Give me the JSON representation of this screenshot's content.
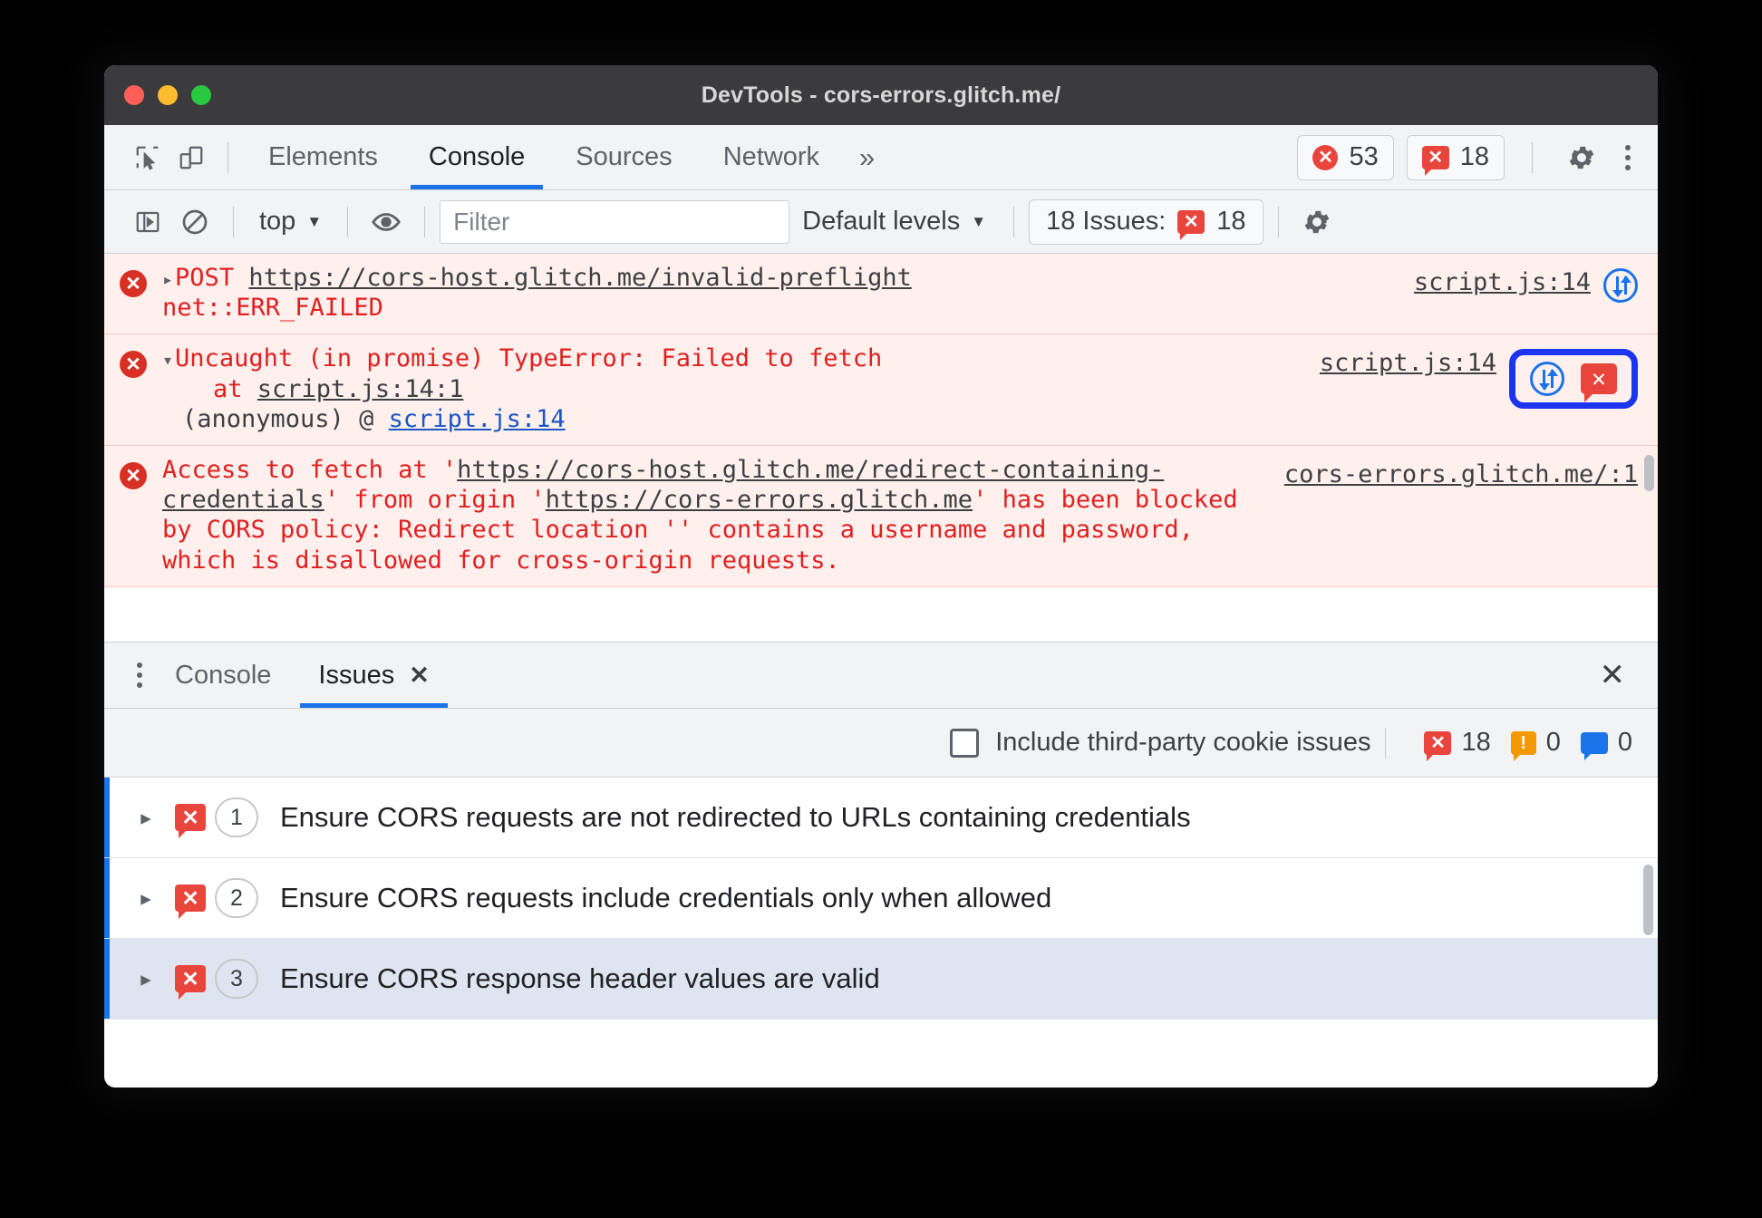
{
  "window": {
    "title": "DevTools - cors-errors.glitch.me/"
  },
  "main_tabs": {
    "inspect_icon": "inspect-cursor-icon",
    "device_icon": "device-toolbar-icon",
    "items": [
      {
        "label": "Elements",
        "active": false
      },
      {
        "label": "Console",
        "active": true
      },
      {
        "label": "Sources",
        "active": false
      },
      {
        "label": "Network",
        "active": false
      }
    ],
    "more_label": "»",
    "error_count": "53",
    "issue_count": "18",
    "settings_icon": "gear-icon",
    "menu_icon": "kebab-menu-icon"
  },
  "console_toolbar": {
    "sidebar_icon": "console-sidebar-icon",
    "clear_icon": "clear-console-icon",
    "context": "top",
    "eye_icon": "live-expression-icon",
    "filter_placeholder": "Filter",
    "filter_value": "",
    "levels": "Default levels",
    "issues_label": "18 Issues:",
    "issues_badge": "18",
    "settings_icon": "gear-icon"
  },
  "console_messages": [
    {
      "kind": "network-error",
      "expander": "▸",
      "method": "POST",
      "url": "https://cors-host.glitch.me/invalid-preflight",
      "detail": "net::ERR_FAILED",
      "source": "script.js:14",
      "network_icon": "network-request-icon"
    },
    {
      "kind": "uncaught-error",
      "expander": "▾",
      "text": "Uncaught (in promise) TypeError: Failed to fetch",
      "stack_prefix": "at ",
      "stack_link": "script.js:14:1",
      "anon_prefix": "(anonymous) @ ",
      "anon_link": "script.js:14",
      "source": "script.js:14",
      "network_icon": "network-request-icon",
      "issue_icon": "issue-bubble-icon",
      "highlighted": true
    },
    {
      "kind": "cors-error",
      "text_1": "Access to fetch at '",
      "link_1": "https://cors-host.glitch.me/redirect-containing-credentials",
      "text_2": "' from origin '",
      "link_2": "https://cors-errors.glitch.me",
      "text_3": "' has been blocked by CORS policy: Redirect location '' contains a username and password, which is disallowed for cross-origin requests.",
      "source": "cors-errors.glitch.me/:1"
    }
  ],
  "drawer": {
    "menu_icon": "kebab-menu-icon",
    "tabs": [
      {
        "label": "Console",
        "active": false,
        "closable": false
      },
      {
        "label": "Issues",
        "active": true,
        "closable": true
      }
    ],
    "close_icon": "close-icon",
    "checkbox_label": "Include third-party cookie issues",
    "checkbox_checked": false,
    "counts": {
      "errors": "18",
      "warnings": "0",
      "info": "0"
    }
  },
  "issues": [
    {
      "count": "1",
      "title": "Ensure CORS requests are not redirected to URLs containing credentials",
      "selected": false
    },
    {
      "count": "2",
      "title": "Ensure CORS requests include credentials only when allowed",
      "selected": false
    },
    {
      "count": "3",
      "title": "Ensure CORS response header values are valid",
      "selected": true
    }
  ],
  "colors": {
    "accent": "#1a73e8",
    "error": "#e8453c",
    "highlight_box": "#1b35f0",
    "error_bg": "#fff0ee"
  }
}
